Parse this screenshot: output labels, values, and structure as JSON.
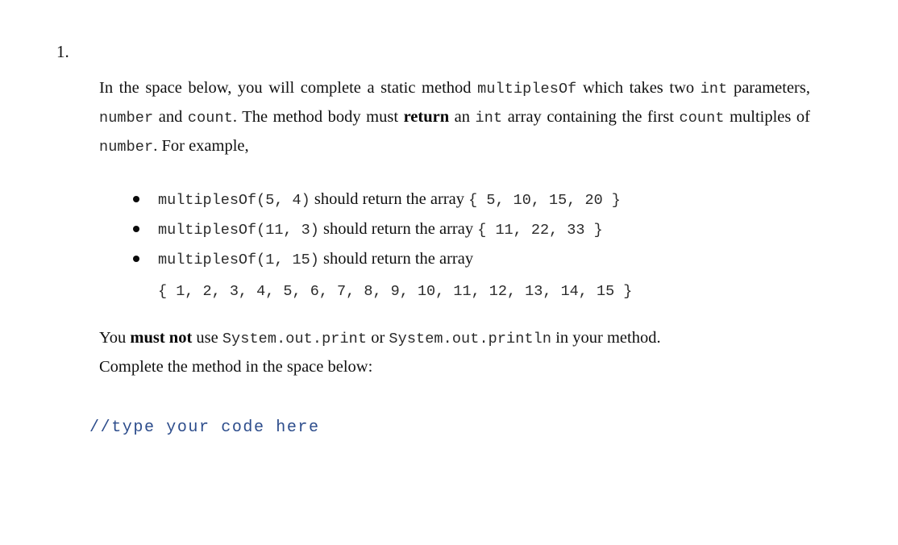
{
  "question": {
    "number": "1.",
    "intro": {
      "seg1": "In the space below, you will complete a static method ",
      "code1": "multiplesOf",
      "seg2": " which takes two ",
      "code2": "int",
      "seg3": " parameters, ",
      "code3": "number",
      "seg4": " and ",
      "code4": "count",
      "seg5": ". The method body must ",
      "bold1": "return",
      "seg6": " an ",
      "code5": "int",
      "seg7": " array containing the first ",
      "code6": "count",
      "seg8": " multiples of ",
      "code7": "number",
      "seg9": ". For example,"
    },
    "examples": [
      {
        "call": "multiplesOf(5, 4)",
        "middle": " should return the array ",
        "result": "{ 5, 10, 15, 20 }",
        "continuation": ""
      },
      {
        "call": "multiplesOf(11, 3)",
        "middle": " should return the array ",
        "result": "{ 11, 22, 33 }",
        "continuation": ""
      },
      {
        "call": "multiplesOf(1, 15)",
        "middle": " should return the array",
        "result": "",
        "continuation": "{ 1, 2, 3, 4, 5, 6, 7, 8, 9, 10, 11, 12, 13, 14, 15 }"
      }
    ],
    "closing": {
      "line1_seg1": "You ",
      "line1_bold": "must not",
      "line1_seg2": " use ",
      "line1_code1": "System.out.print",
      "line1_seg3": " or ",
      "line1_code2": "System.out.println",
      "line1_seg4": " in your method.",
      "line2": "Complete the method in the space below:"
    },
    "answer_placeholder": "//type your code here"
  },
  "colors": {
    "page_background": "#ffffff",
    "body_text": "#101010",
    "code_text": "#2b2b2b",
    "comment_blue": "#2d4d8c",
    "bullet_dot": "#0b0b0b"
  }
}
